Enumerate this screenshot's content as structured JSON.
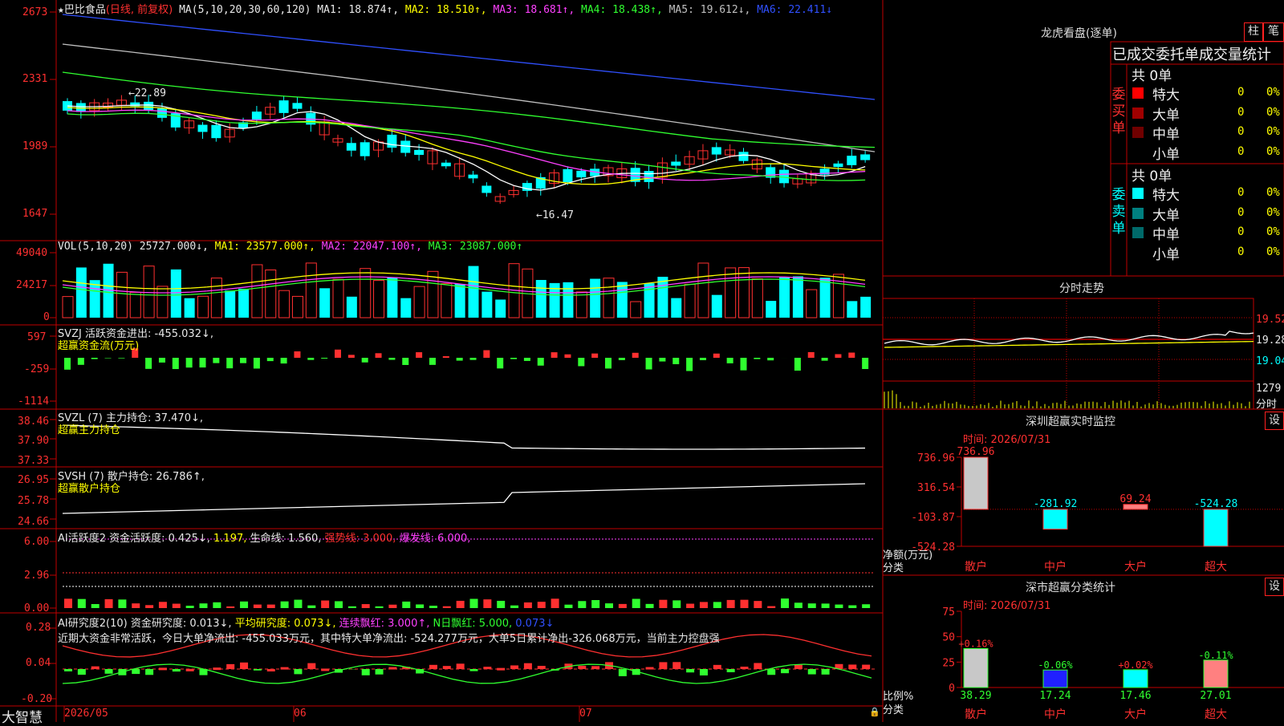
{
  "stock": {
    "name": "巴比食品",
    "mode": "(日线, 前复权)"
  },
  "colors": {
    "up": "#ff3030",
    "down": "#00ffff",
    "grid": "#c00000",
    "ma1": "#ffffff",
    "ma2": "#ffff00",
    "ma3": "#ff40ff",
    "ma4": "#30ff30",
    "ma5": "#c0c0c0",
    "ma6": "#3050ff"
  },
  "main_chart": {
    "ma_label": "MA(5,10,20,30,60,120)",
    "ma1": "MA1: 18.874↑,",
    "ma2": "MA2: 18.510↑,",
    "ma3": "MA3: 18.681↑,",
    "ma4": "MA4: 18.438↑,",
    "ma5": "MA5: 19.612↓,",
    "ma6": "MA6: 22.411↓",
    "y_ticks": [
      "2673",
      "2331",
      "1989",
      "1647"
    ],
    "high_label": "22.89",
    "low_label": "16.47"
  },
  "vol_panel": {
    "label": "VOL(5,10,20)",
    "val": "25727.000↓,",
    "ma1": "MA1: 23577.000↑,",
    "ma2": "MA2: 22047.100↑,",
    "ma3": "MA3: 23087.000↑",
    "y_ticks": [
      "49040",
      "24217",
      "0"
    ]
  },
  "svzj_panel": {
    "label": "SVZJ  活跃资金进出: -455.032↓,",
    "sub": "超赢资金流(万元)",
    "y_ticks": [
      "597",
      "-259",
      "-1114"
    ]
  },
  "svzl_panel": {
    "label": "SVZL (7) 主力持仓: 37.470↓,",
    "sub": "超赢主力持仓",
    "y_ticks": [
      "38.46",
      "37.90",
      "37.33"
    ]
  },
  "svsh_panel": {
    "label": "SVSH (7) 散户持仓: 26.786↑,",
    "sub": "超赢散户持仓",
    "y_ticks": [
      "26.95",
      "25.78",
      "24.66"
    ]
  },
  "ai_active_panel": {
    "label": "AI活跃度2 资金活跃度: 0.425↓,",
    "v2": "1.197,",
    "v3": "生命线: 1.560,",
    "v4": "强势线: 3.000,",
    "v5": "爆发线: 6.000,",
    "y_ticks": [
      "6.00",
      "2.96",
      "0.00"
    ]
  },
  "ai_research_panel": {
    "label": "AI研究度2(10) 资金研究度: 0.013↓,",
    "v2": "平均研究度: 0.073↓,",
    "v3": "连续飘红: 3.000↑,",
    "v4": "N日飘红: 5.000,",
    "v5": "0.073↓",
    "comment": "近期大资金非常活跃，今日大单净流出: -455.033万元，其中特大单净流出: -524.277万元，大单5日累计净出-326.068万元，当前主力控盘强",
    "y_ticks": [
      "0.28",
      "0.04",
      "-0.20"
    ]
  },
  "x_axis": {
    "labels": [
      "2026/05",
      "06",
      "07"
    ],
    "brand": "大智慧"
  },
  "right_panel": {
    "lhb_title": "龙虎看盘(逐单)",
    "btn_zhu": "柱",
    "btn_bi": "笔",
    "stat_title": "已成交委托单成交量统计",
    "buy": {
      "side": "委买单",
      "total": "共 0单",
      "rows": [
        {
          "label": "特大",
          "count": "0",
          "pct": "0%",
          "color": "#ff0000"
        },
        {
          "label": "大单",
          "count": "0",
          "pct": "0%",
          "color": "#a00000"
        },
        {
          "label": "中单",
          "count": "0",
          "pct": "0%",
          "color": "#700000"
        },
        {
          "label": "小单",
          "count": "0",
          "pct": "0%",
          "color": "#000000"
        }
      ]
    },
    "sell": {
      "side": "委卖单",
      "total": "共 0单",
      "rows": [
        {
          "label": "特大",
          "count": "0",
          "pct": "0%",
          "color": "#00ffff"
        },
        {
          "label": "大单",
          "count": "0",
          "pct": "0%",
          "color": "#008080"
        },
        {
          "label": "中单",
          "count": "0",
          "pct": "0%",
          "color": "#006a6a"
        },
        {
          "label": "小单",
          "count": "0",
          "pct": "0%",
          "color": "#000000"
        }
      ]
    },
    "intraday_title": "分时走势",
    "intraday_ticks": [
      "19.52",
      "19.28",
      "19.04"
    ],
    "intraday_vol": "1279",
    "intraday_vol_label": "分时",
    "monitor_title": "深圳超赢实时监控",
    "monitor_btn": "设",
    "monitor_time": "时间: 2026/07/31",
    "monitor_ticks": [
      "736.96",
      "316.54",
      "-103.87",
      "-524.28"
    ],
    "monitor_ylabel": "净额(万元)",
    "monitor_xlabel": "分类",
    "monitor_cats": [
      "散户",
      "中户",
      "大户",
      "超大"
    ],
    "monitor_values": [
      "736.96",
      "-281.92",
      "69.24",
      "-524.28"
    ],
    "class_title": "深市超赢分类统计",
    "class_btn": "设",
    "class_time": "时间: 2026/07/31",
    "class_ticks": [
      "75",
      "50",
      "25",
      "0"
    ],
    "class_ylabel": "比例%",
    "class_xlabel": "分类",
    "class_cats": [
      "散户",
      "中户",
      "大户",
      "超大"
    ],
    "class_changes": [
      "+0.16%",
      "-0.06%",
      "+0.02%",
      "-0.11%"
    ],
    "class_values": [
      "38.29",
      "17.24",
      "17.46",
      "27.01"
    ]
  },
  "chart_data": [
    {
      "type": "bar",
      "title": "深圳超赢实时监控",
      "categories": [
        "散户",
        "中户",
        "大户",
        "超大"
      ],
      "values": [
        736.96,
        -281.92,
        69.24,
        -524.28
      ],
      "ylabel": "净额(万元)",
      "xlabel": "分类",
      "ylim": [
        -524.28,
        736.96
      ]
    },
    {
      "type": "bar",
      "title": "深市超赢分类统计",
      "categories": [
        "散户",
        "中户",
        "大户",
        "超大"
      ],
      "values": [
        38.29,
        17.24,
        17.46,
        27.01
      ],
      "ylabel": "比例%",
      "xlabel": "分类",
      "ylim": [
        0,
        75
      ]
    }
  ]
}
